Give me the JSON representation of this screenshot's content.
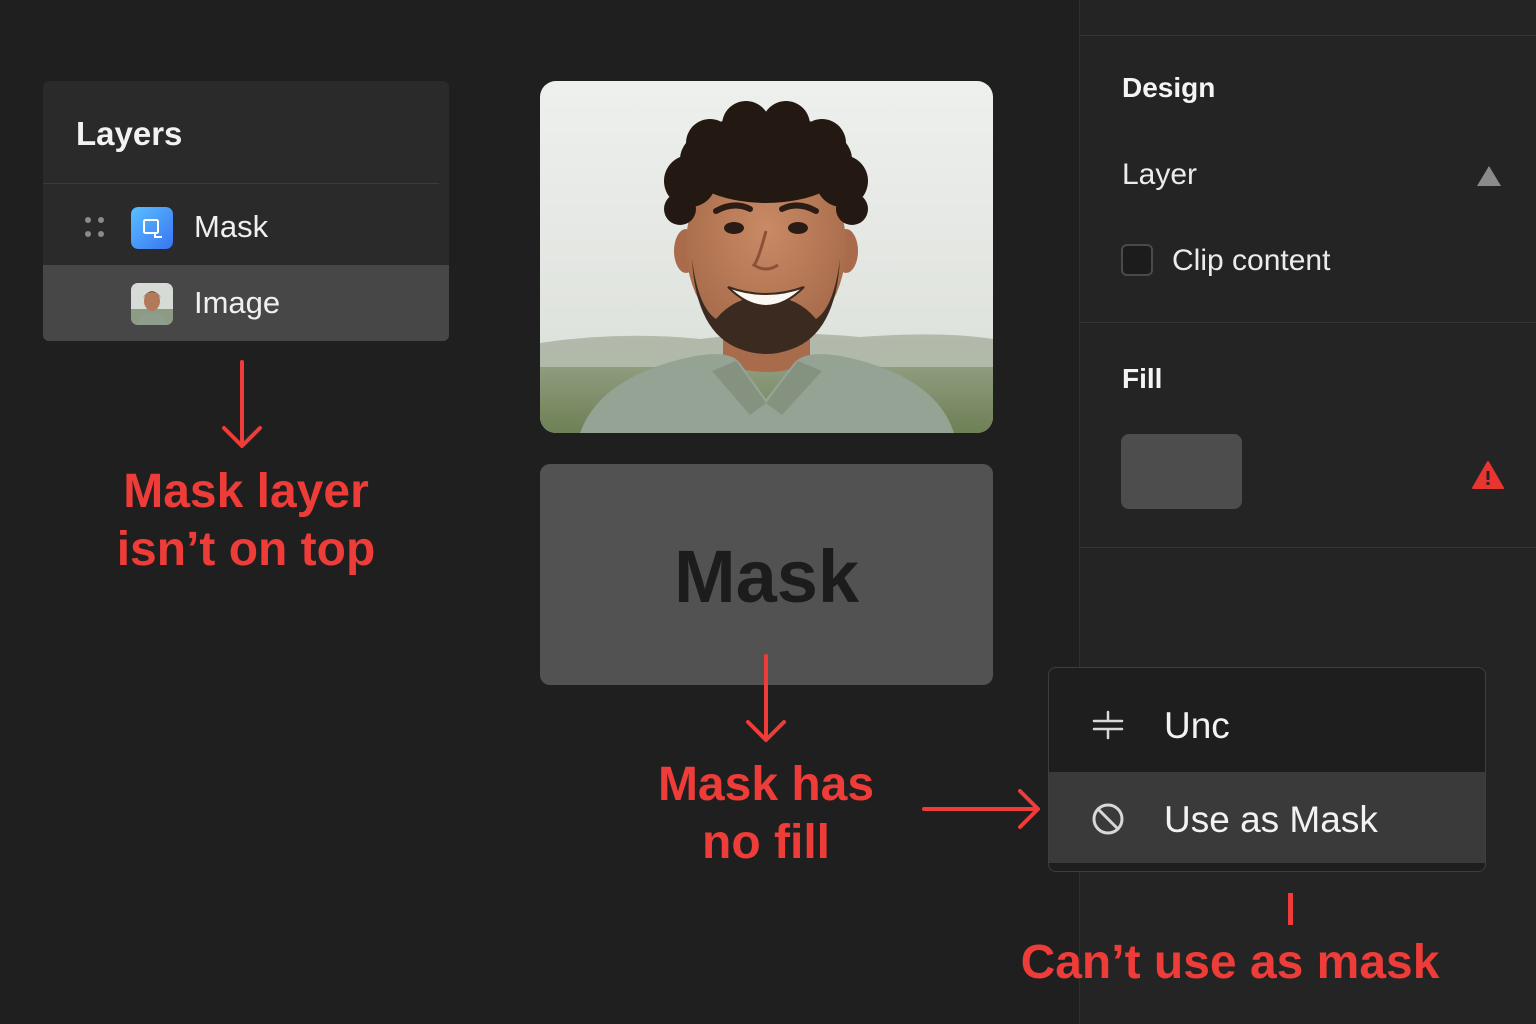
{
  "layers": {
    "title": "Layers",
    "items": [
      {
        "label": "Mask",
        "icon": "mask-layer-icon"
      },
      {
        "label": "Image",
        "icon": "image-thumbnail"
      }
    ]
  },
  "annotations": {
    "layer_order": [
      "Mask layer",
      "isn’t on top"
    ],
    "no_fill": [
      "Mask has",
      "no fill"
    ],
    "cant_mask": "Can’t use as mask"
  },
  "canvas": {
    "mask_label": "Mask"
  },
  "design_panel": {
    "title": "Design",
    "layer_section": {
      "label": "Layer",
      "clip_content_label": "Clip content",
      "clip_content_checked": false
    },
    "fill_section": {
      "title": "Fill",
      "swatch_color": "#4d4d4d"
    }
  },
  "context_menu": {
    "items": [
      {
        "label": "Unc",
        "icon": "ungroup-icon"
      },
      {
        "label": "Use as Mask",
        "icon": "prohibited-icon",
        "highlighted": true
      }
    ]
  },
  "colors": {
    "background": "#1f1f1f",
    "panel": "#2a2a2a",
    "annotation_red": "#ee3c38",
    "layer_icon_blue": "#3a8df5",
    "warning_red": "#e8352f"
  }
}
